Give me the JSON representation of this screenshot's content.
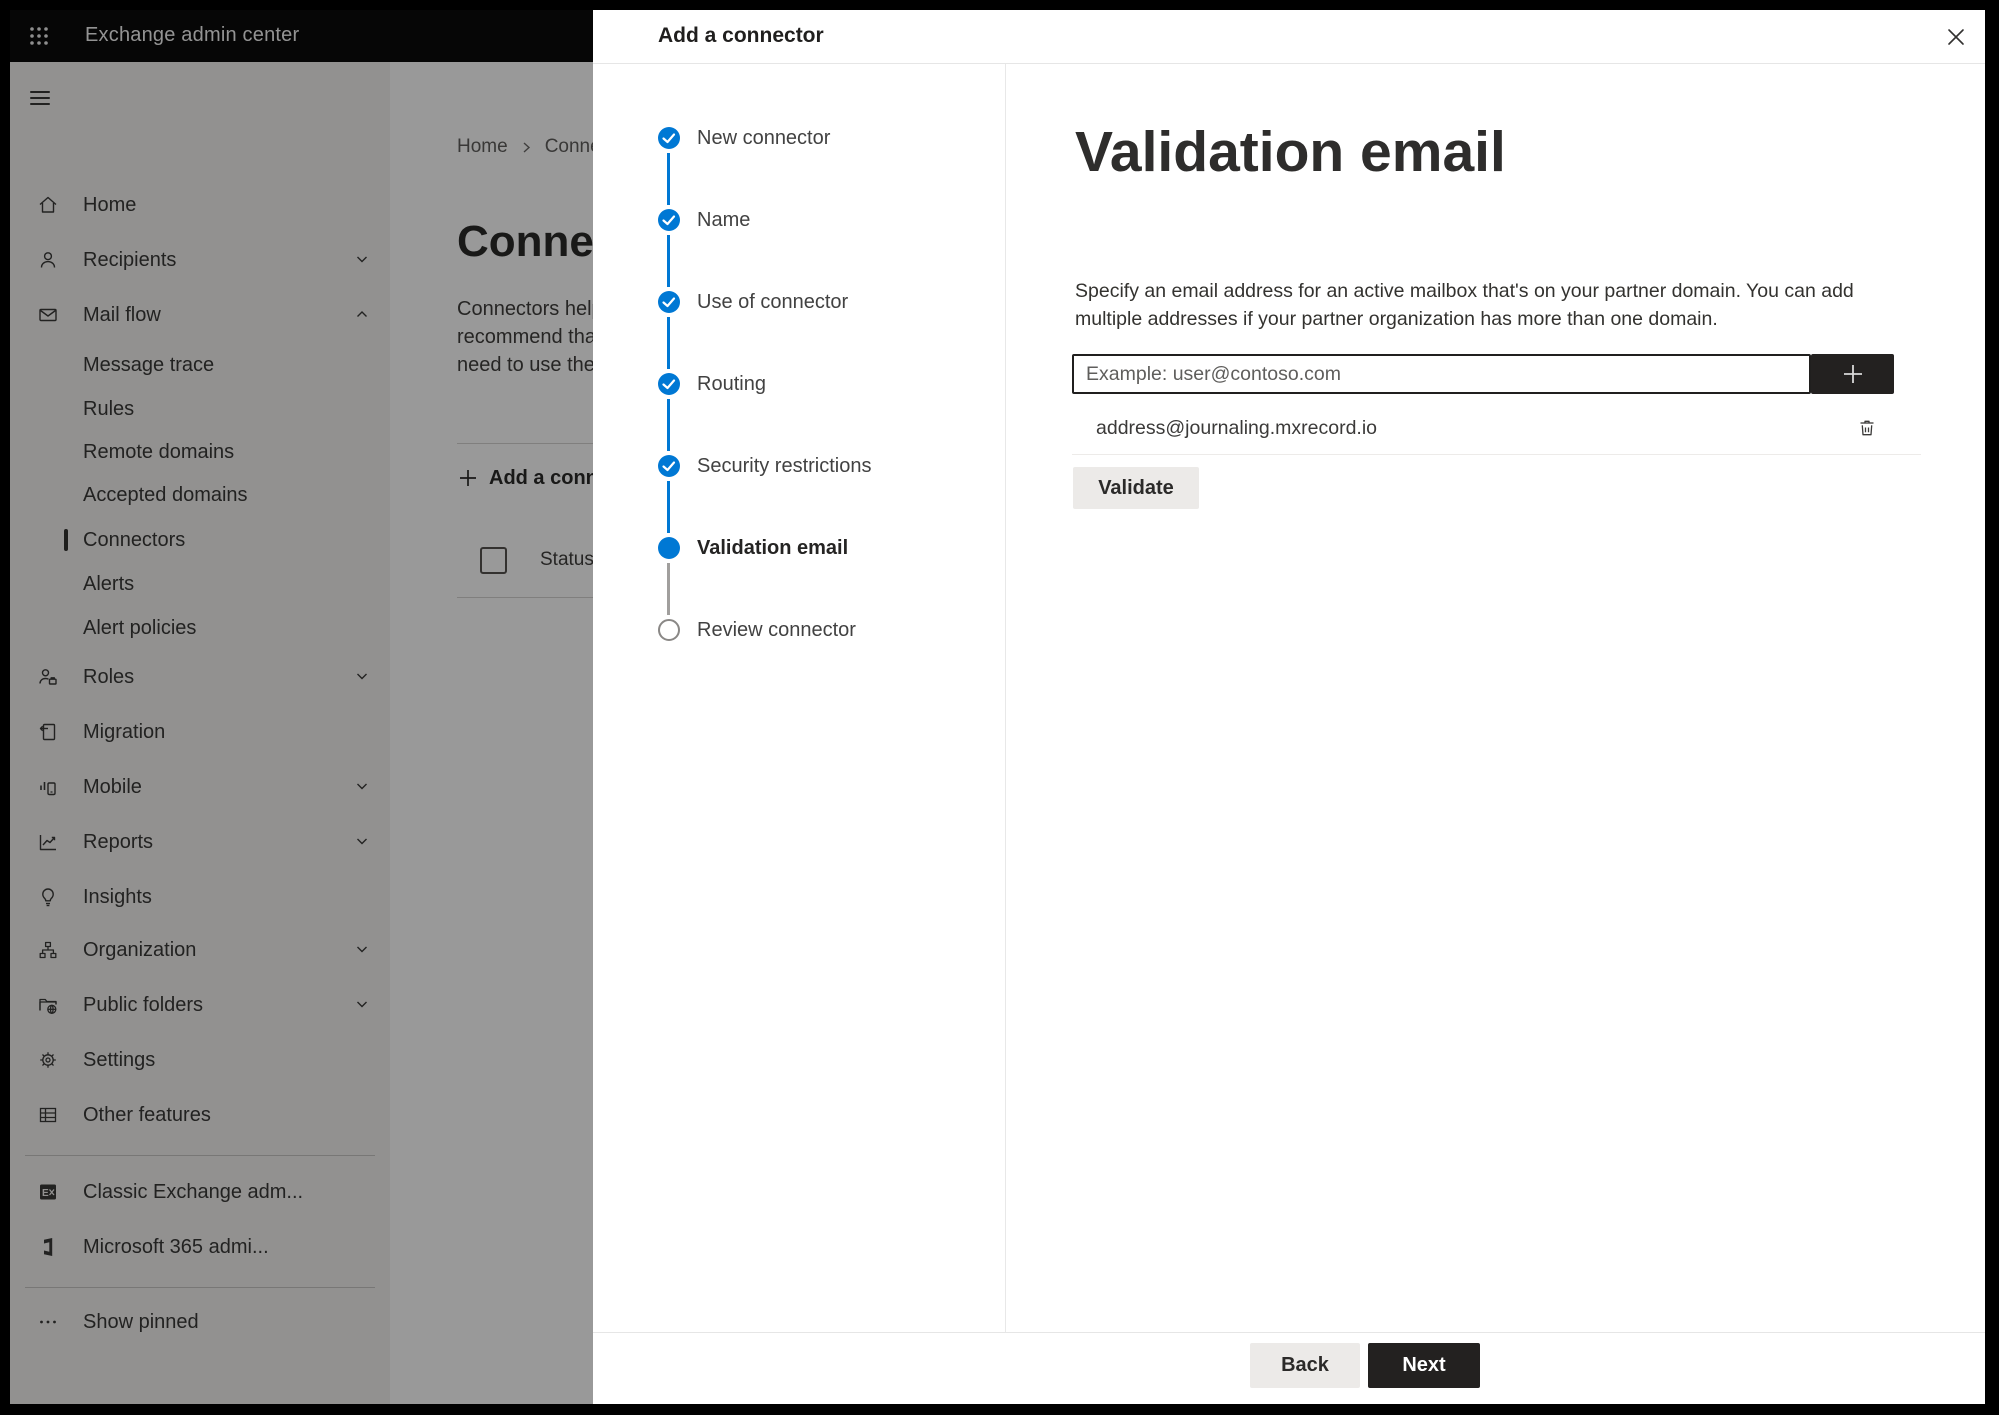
{
  "topbar": {
    "title": "Exchange admin center"
  },
  "sidebar": {
    "items": [
      {
        "label": "Home"
      },
      {
        "label": "Recipients"
      },
      {
        "label": "Mail flow"
      },
      {
        "label": "Message trace"
      },
      {
        "label": "Rules"
      },
      {
        "label": "Remote domains"
      },
      {
        "label": "Accepted domains"
      },
      {
        "label": "Connectors",
        "selected": true
      },
      {
        "label": "Alerts"
      },
      {
        "label": "Alert policies"
      },
      {
        "label": "Roles"
      },
      {
        "label": "Migration"
      },
      {
        "label": "Mobile"
      },
      {
        "label": "Reports"
      },
      {
        "label": "Insights"
      },
      {
        "label": "Organization"
      },
      {
        "label": "Public folders"
      },
      {
        "label": "Settings"
      },
      {
        "label": "Other features"
      },
      {
        "label": "Classic Exchange adm..."
      },
      {
        "label": "Microsoft 365 admi..."
      },
      {
        "label": "Show pinned"
      }
    ]
  },
  "main": {
    "breadcrumb": [
      "Home",
      "Conne"
    ],
    "heading": "Connec",
    "paragraph_lines": [
      "Connectors help",
      "recommend that",
      "need to use ther"
    ],
    "add_button": "Add a conn",
    "table": {
      "col_status": "Status"
    }
  },
  "modal": {
    "title": "Add a connector",
    "steps": [
      {
        "label": "New connector",
        "state": "done"
      },
      {
        "label": "Name",
        "state": "done"
      },
      {
        "label": "Use of connector",
        "state": "done"
      },
      {
        "label": "Routing",
        "state": "done"
      },
      {
        "label": "Security restrictions",
        "state": "done"
      },
      {
        "label": "Validation email",
        "state": "current"
      },
      {
        "label": "Review connector",
        "state": "todo"
      }
    ],
    "content": {
      "heading": "Validation email",
      "description_lines": [
        "Specify an email address for an active mailbox that's on your partner domain. You can add",
        "multiple addresses if your partner organization has more than one domain."
      ],
      "email_input": {
        "value": "",
        "placeholder": "Example: user@contoso.com"
      },
      "email_list": [
        {
          "address": "address@journaling.mxrecord.io"
        }
      ],
      "validate_button": "Validate"
    },
    "footer": {
      "back": "Back",
      "next": "Next"
    }
  },
  "colors": {
    "accent": "#0078d4",
    "dark_button": "#232120",
    "topbar": "#0a0a0a"
  }
}
